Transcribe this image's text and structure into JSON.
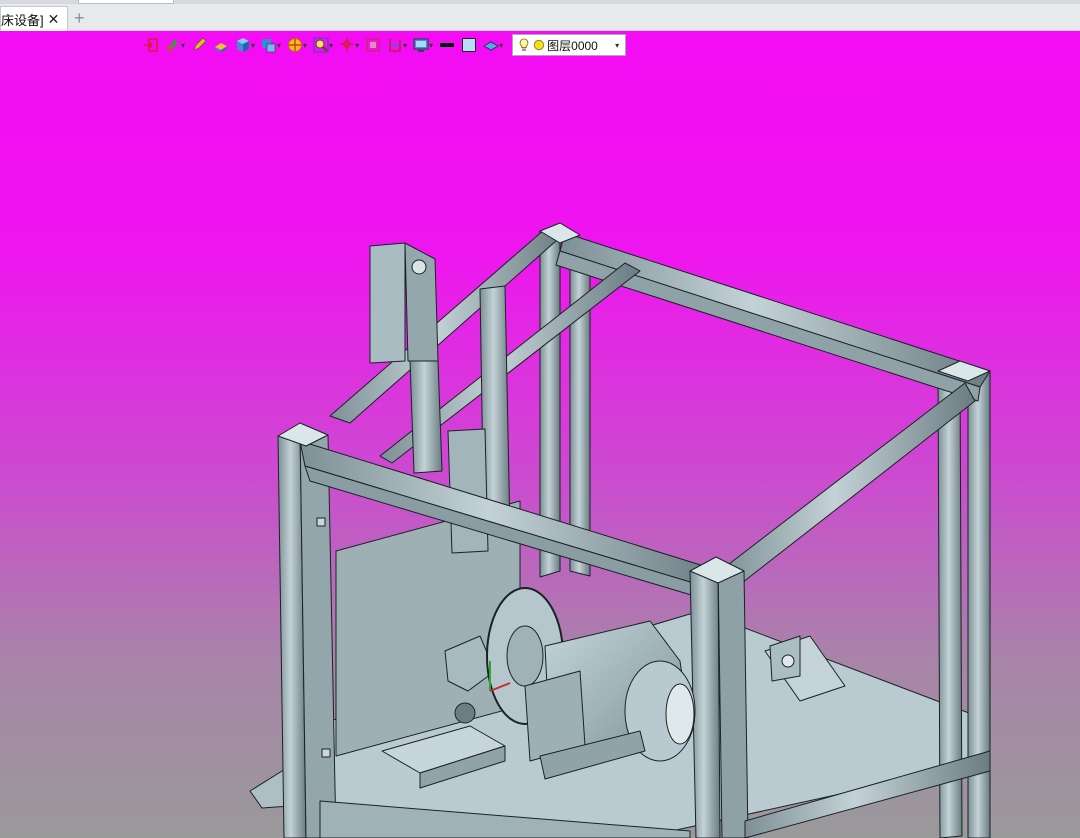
{
  "tabs": [
    {
      "label": "床设备]"
    }
  ],
  "tab_add_label": "+",
  "toolbar": {
    "icons": [
      {
        "name": "exit-sketch-icon",
        "dropdown": false
      },
      {
        "name": "sketch-tools-icon",
        "dropdown": true
      },
      {
        "name": "pencil-icon",
        "dropdown": false
      },
      {
        "name": "eraser-icon",
        "dropdown": false
      },
      {
        "name": "solid-cube-icon",
        "dropdown": true
      },
      {
        "name": "boolean-icon",
        "dropdown": true
      },
      {
        "name": "render-style-icon",
        "dropdown": true
      },
      {
        "name": "zoom-icon",
        "dropdown": true
      },
      {
        "name": "origin-icon",
        "dropdown": true
      },
      {
        "name": "frame-icon",
        "dropdown": false
      },
      {
        "name": "section-icon",
        "dropdown": true
      },
      {
        "name": "display-icon",
        "dropdown": true
      },
      {
        "name": "line-color-icon",
        "dropdown": false
      },
      {
        "name": "fill-color-icon",
        "dropdown": false
      },
      {
        "name": "layer-plane-icon",
        "dropdown": true
      }
    ],
    "layer": {
      "value": "图层0000"
    }
  },
  "colors": {
    "background_top": "#f40cf4",
    "background_bottom": "#9a9a9a",
    "frame": "#b8c8cc",
    "frame_dark": "#6f8086",
    "line": "#1a2226"
  }
}
